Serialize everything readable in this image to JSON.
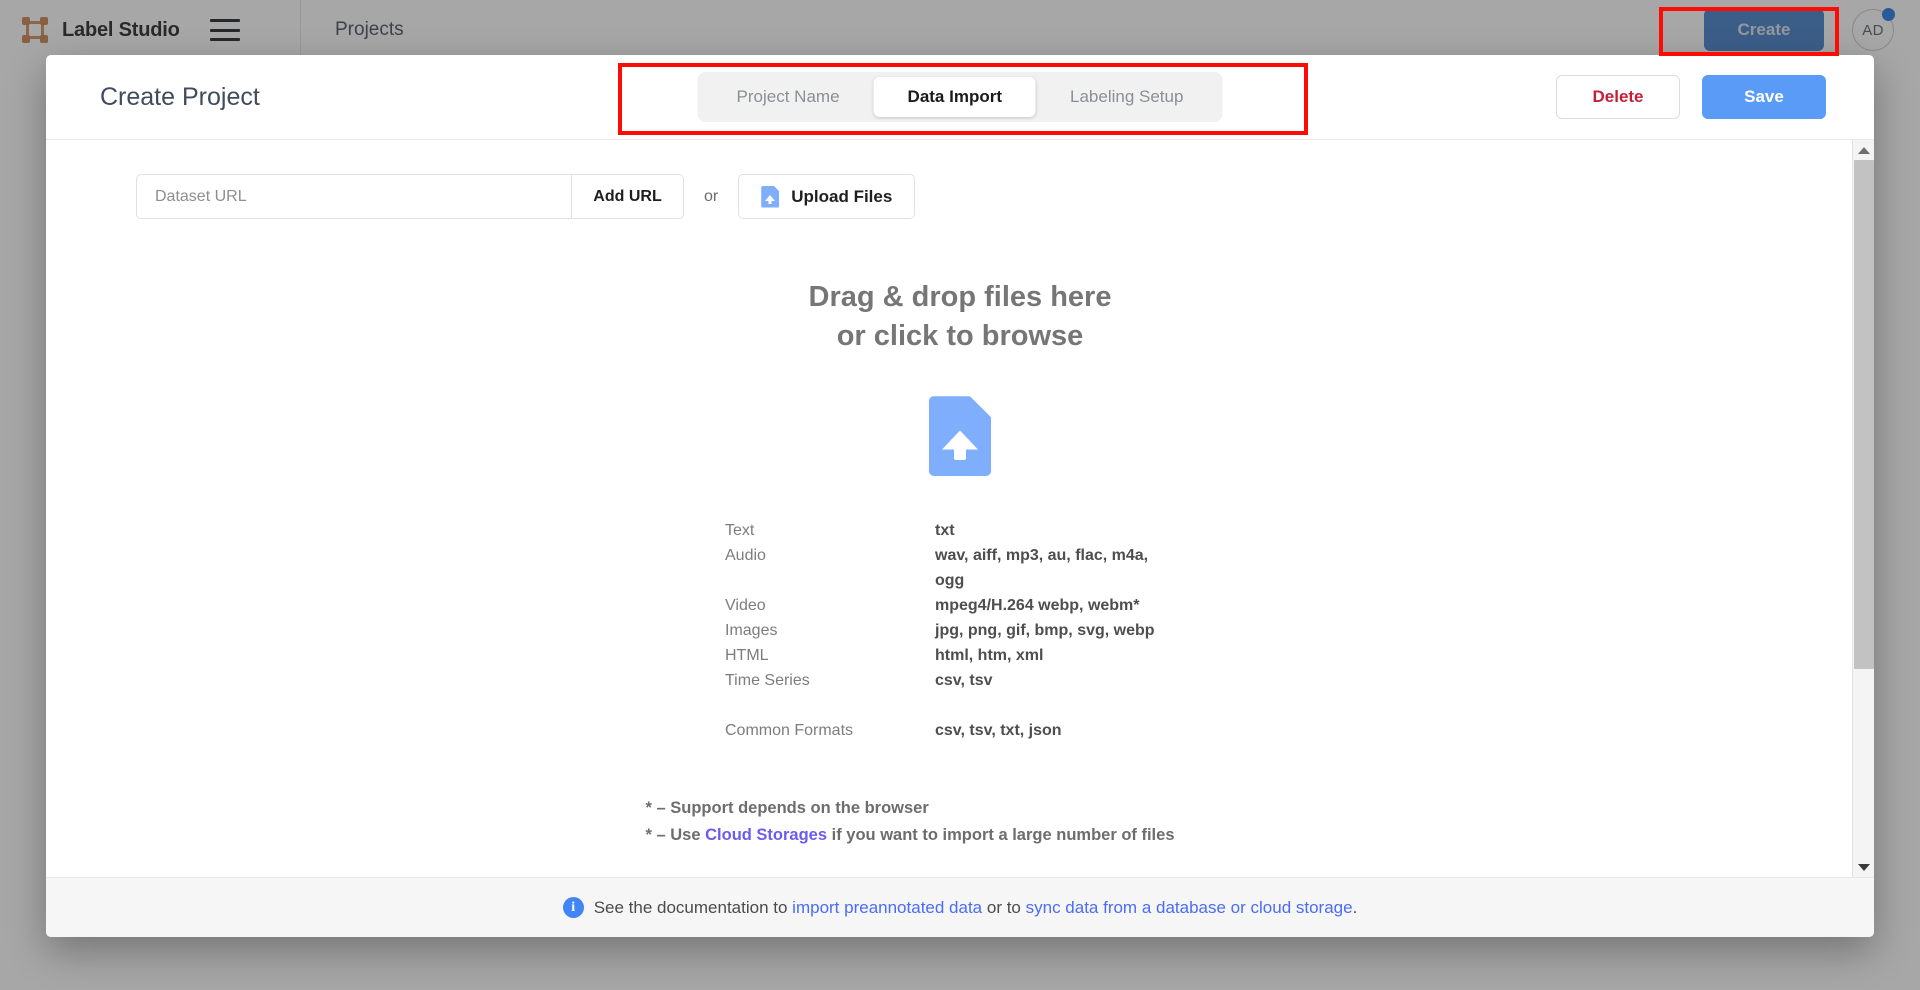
{
  "topbar": {
    "brand_name": "Label Studio",
    "menu_icon": "hamburger-menu-icon",
    "breadcrumb": "Projects",
    "create_label": "Create",
    "avatar_initials": "AD",
    "accent_blue": "#3b7ac9",
    "notification_color": "#1a73e8"
  },
  "modal": {
    "title": "Create Project",
    "tabs": [
      {
        "label": "Project Name",
        "active": false
      },
      {
        "label": "Data Import",
        "active": true
      },
      {
        "label": "Labeling Setup",
        "active": false
      }
    ],
    "delete_label": "Delete",
    "save_label": "Save",
    "delete_color": "#c2213a",
    "save_color": "#5b9bf8"
  },
  "import": {
    "url_placeholder": "Dataset URL",
    "url_value": "",
    "add_url_label": "Add URL",
    "or_label": "or",
    "upload_label": "Upload Files",
    "upload_icon": "file-upload-icon",
    "dropzone_line1": "Drag & drop files here",
    "dropzone_line2": "or click to browse",
    "dropzone_icon": "file-upload-large-icon",
    "formats": [
      {
        "label": "Text",
        "value": "txt"
      },
      {
        "label": "Audio",
        "value": "wav, aiff, mp3, au, flac, m4a, ogg"
      },
      {
        "label": "Video",
        "value": "mpeg4/H.264 webp, webm*"
      },
      {
        "label": "Images",
        "value": "jpg, png, gif, bmp, svg, webp"
      },
      {
        "label": "HTML",
        "value": "html, htm, xml"
      },
      {
        "label": "Time Series",
        "value": "csv, tsv"
      }
    ],
    "common_formats": {
      "label": "Common Formats",
      "value": "csv, tsv, txt, json"
    },
    "footnote1": "* – Support depends on the browser",
    "footnote2_pre": "* – Use ",
    "footnote2_link": "Cloud Storages",
    "footnote2_post": " if you want to import a large number of files",
    "link_color": "#6a5cf0"
  },
  "footer": {
    "info_icon": "info-icon",
    "info_glyph": "i",
    "text_pre": "See the documentation to ",
    "link1": "import preannotated data",
    "text_mid": " or to ",
    "link2": "sync data from a database or cloud storage",
    "text_post": ".",
    "link_color": "#4a6cf7"
  },
  "scrollbar": {
    "up_icon": "scroll-up-arrow-icon",
    "down_icon": "scroll-down-arrow-icon"
  },
  "annotations": {
    "color": "#fb0d05",
    "boxes": [
      "create-button-highlight",
      "tab-switcher-highlight"
    ]
  }
}
